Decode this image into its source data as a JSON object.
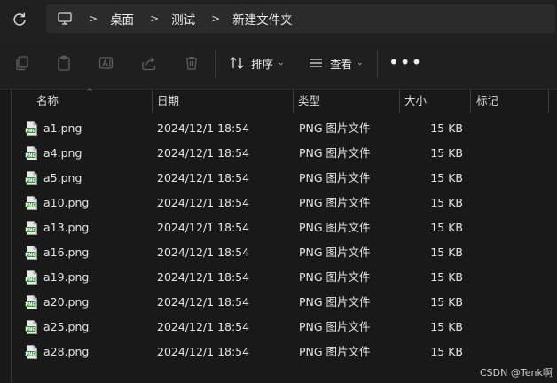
{
  "address": {
    "crumbs": [
      "桌面",
      "测试",
      "新建文件夹"
    ]
  },
  "toolbar": {
    "sort_label": "排序",
    "view_label": "查看",
    "more_label": "•••"
  },
  "columns": {
    "name": "名称",
    "date": "日期",
    "type": "类型",
    "size": "大小",
    "tags": "标记"
  },
  "files": [
    {
      "name": "a1.png",
      "date": "2024/12/1 18:54",
      "type": "PNG 图片文件",
      "size": "15 KB"
    },
    {
      "name": "a4.png",
      "date": "2024/12/1 18:54",
      "type": "PNG 图片文件",
      "size": "15 KB"
    },
    {
      "name": "a5.png",
      "date": "2024/12/1 18:54",
      "type": "PNG 图片文件",
      "size": "15 KB"
    },
    {
      "name": "a10.png",
      "date": "2024/12/1 18:54",
      "type": "PNG 图片文件",
      "size": "15 KB"
    },
    {
      "name": "a13.png",
      "date": "2024/12/1 18:54",
      "type": "PNG 图片文件",
      "size": "15 KB"
    },
    {
      "name": "a16.png",
      "date": "2024/12/1 18:54",
      "type": "PNG 图片文件",
      "size": "15 KB"
    },
    {
      "name": "a19.png",
      "date": "2024/12/1 18:54",
      "type": "PNG 图片文件",
      "size": "15 KB"
    },
    {
      "name": "a20.png",
      "date": "2024/12/1 18:54",
      "type": "PNG 图片文件",
      "size": "15 KB"
    },
    {
      "name": "a25.png",
      "date": "2024/12/1 18:54",
      "type": "PNG 图片文件",
      "size": "15 KB"
    },
    {
      "name": "a28.png",
      "date": "2024/12/1 18:54",
      "type": "PNG 图片文件",
      "size": "15 KB"
    }
  ],
  "file_icon": "png-file-icon",
  "watermark": "CSDN @Tenk啊"
}
